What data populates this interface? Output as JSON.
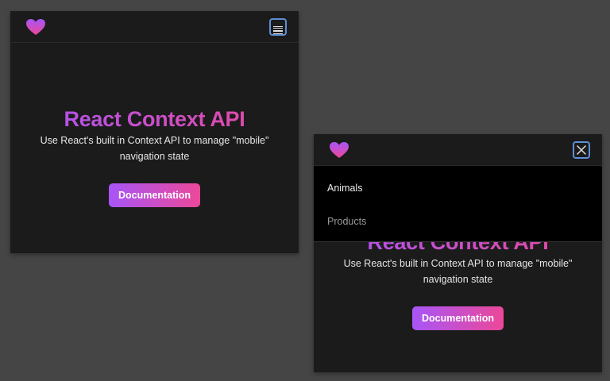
{
  "colors": {
    "accent_start": "#a855f7",
    "accent_end": "#ec4899",
    "focus_ring": "#5d8fd8",
    "background": "#1b1b1b",
    "menu_background": "#000000"
  },
  "closed_view": {
    "logo_icon": "heart-icon",
    "menu_toggle_icon": "hamburger-icon",
    "hero": {
      "title": "React Context API",
      "description": "Use React's built in Context API to manage \"mobile\" navigation state",
      "button_label": "Documentation"
    }
  },
  "open_view": {
    "logo_icon": "heart-icon",
    "menu_toggle_icon": "close-icon",
    "menu_items": [
      {
        "label": "Animals"
      },
      {
        "label": "Products"
      }
    ],
    "hero": {
      "title": "React Context API",
      "description": "Use React's built in Context API to manage \"mobile\" navigation state",
      "button_label": "Documentation"
    }
  }
}
